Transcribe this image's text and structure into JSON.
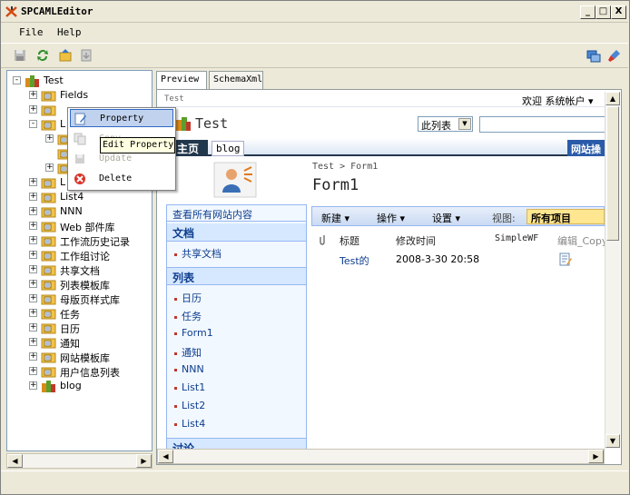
{
  "window": {
    "title": "SPCAMLEditor"
  },
  "window_controls": {
    "minimize": "_",
    "maximize": "□",
    "close": "X"
  },
  "menu": {
    "file": "File",
    "help": "Help"
  },
  "tree": {
    "items": [
      {
        "label": "Test",
        "expander": "-",
        "indent": 0
      },
      {
        "label": "Fields",
        "expander": "+",
        "indent": 1
      },
      {
        "label": "",
        "expander": "+",
        "indent": 1
      },
      {
        "label": "L",
        "expander": "-",
        "indent": 1
      },
      {
        "label": "",
        "expander": "+",
        "indent": 2
      },
      {
        "label": "",
        "expander": "",
        "indent": 2
      },
      {
        "label": "",
        "expander": "+",
        "indent": 2
      },
      {
        "label": "L",
        "expander": "+",
        "indent": 1
      },
      {
        "label": "List4",
        "expander": "+",
        "indent": 1
      },
      {
        "label": "NNN",
        "expander": "+",
        "indent": 1
      },
      {
        "label": "Web 部件库",
        "expander": "+",
        "indent": 1
      },
      {
        "label": "工作流历史记录",
        "expander": "+",
        "indent": 1
      },
      {
        "label": "工作组讨论",
        "expander": "+",
        "indent": 1
      },
      {
        "label": "共享文档",
        "expander": "+",
        "indent": 1
      },
      {
        "label": "列表模板库",
        "expander": "+",
        "indent": 1
      },
      {
        "label": "母版页样式库",
        "expander": "+",
        "indent": 1
      },
      {
        "label": "任务",
        "expander": "+",
        "indent": 1
      },
      {
        "label": "日历",
        "expander": "+",
        "indent": 1
      },
      {
        "label": "通知",
        "expander": "+",
        "indent": 1
      },
      {
        "label": "网站模板库",
        "expander": "+",
        "indent": 1
      },
      {
        "label": "用户信息列表",
        "expander": "+",
        "indent": 1
      },
      {
        "label": "blog",
        "expander": "+",
        "indent": 1
      }
    ]
  },
  "context_menu": {
    "items": [
      {
        "label": "Property",
        "icon": "property-icon",
        "state": "highlighted"
      },
      {
        "label": "Copy",
        "icon": "copy-icon",
        "state": "disabled"
      },
      {
        "label": "Update",
        "icon": "update-icon",
        "state": "disabled"
      },
      {
        "label": "Delete",
        "icon": "delete-icon",
        "state": "normal"
      }
    ]
  },
  "tooltip": {
    "text": "Edit Property"
  },
  "tabs": [
    {
      "label": "Preview",
      "active": true
    },
    {
      "label": "SchemaXml",
      "active": false
    }
  ],
  "sp": {
    "breadcrumb_site": "Test",
    "welcome": "欢迎 系统帐户 ▾",
    "site_title": "Test",
    "search_scope": "此列表",
    "nav_tabs": [
      "主页",
      "blog"
    ],
    "site_actions": "网站操",
    "page_breadcrumb": "Test > Form1",
    "page_title": "Form1",
    "view_all": "查看所有网站内容",
    "quicklaunch": {
      "docs_header": "文档",
      "docs": [
        "共享文档"
      ],
      "lists_header": "列表",
      "lists": [
        "日历",
        "任务",
        "Form1",
        "通知",
        "NNN",
        "List1",
        "List2",
        "List4"
      ],
      "discuss_header": "讨论"
    },
    "toolbar": {
      "new": "新建 ▾",
      "actions": "操作 ▾",
      "settings": "设置 ▾",
      "view_label": "视图:",
      "view_value": "所有项目"
    },
    "columns": [
      "标题",
      "修改时间",
      "SimpleWF",
      "编辑_Copy"
    ],
    "rows": [
      {
        "title": "Test的",
        "modified": "2008-3-30 20:58",
        "wf": "",
        "edit": "edit-doc-icon"
      }
    ]
  }
}
